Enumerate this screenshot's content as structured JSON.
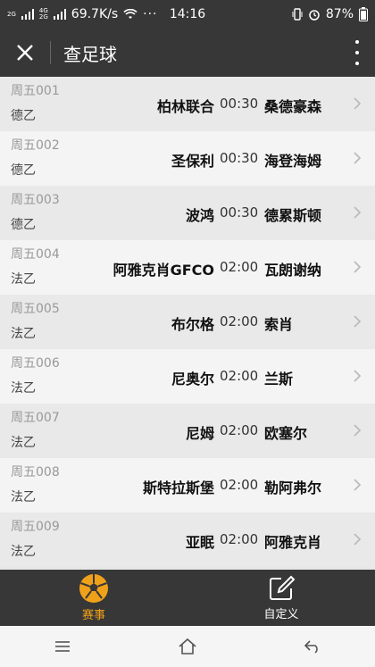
{
  "status": {
    "net_top": "2G",
    "net_mid_top": "4G",
    "net_mid_bottom": "2G",
    "speed": "69.7K/s",
    "dots": "···",
    "time": "14:16",
    "battery": "87%"
  },
  "header": {
    "title": "查足球"
  },
  "matches": [
    {
      "no": "周五001",
      "league": "德乙",
      "home": "柏林联合",
      "time": "00:30",
      "away": "桑德豪森"
    },
    {
      "no": "周五002",
      "league": "德乙",
      "home": "圣保利",
      "time": "00:30",
      "away": "海登海姆"
    },
    {
      "no": "周五003",
      "league": "德乙",
      "home": "波鸿",
      "time": "00:30",
      "away": "德累斯顿"
    },
    {
      "no": "周五004",
      "league": "法乙",
      "home": "阿雅克肖GFCO",
      "time": "02:00",
      "away": "瓦朗谢纳"
    },
    {
      "no": "周五005",
      "league": "法乙",
      "home": "布尔格",
      "time": "02:00",
      "away": "索肖"
    },
    {
      "no": "周五006",
      "league": "法乙",
      "home": "尼奥尔",
      "time": "02:00",
      "away": "兰斯"
    },
    {
      "no": "周五007",
      "league": "法乙",
      "home": "尼姆",
      "time": "02:00",
      "away": "欧塞尔"
    },
    {
      "no": "周五008",
      "league": "法乙",
      "home": "斯特拉斯堡",
      "time": "02:00",
      "away": "勒阿弗尔"
    },
    {
      "no": "周五009",
      "league": "法乙",
      "home": "亚眠",
      "time": "02:00",
      "away": "阿雅克肖"
    }
  ],
  "tabs": [
    {
      "label": "赛事",
      "icon": "soccer-ball-icon",
      "active": true
    },
    {
      "label": "自定义",
      "icon": "edit-icon",
      "active": false
    }
  ],
  "colors": {
    "accent": "#f0a11a",
    "bar": "#373737"
  }
}
